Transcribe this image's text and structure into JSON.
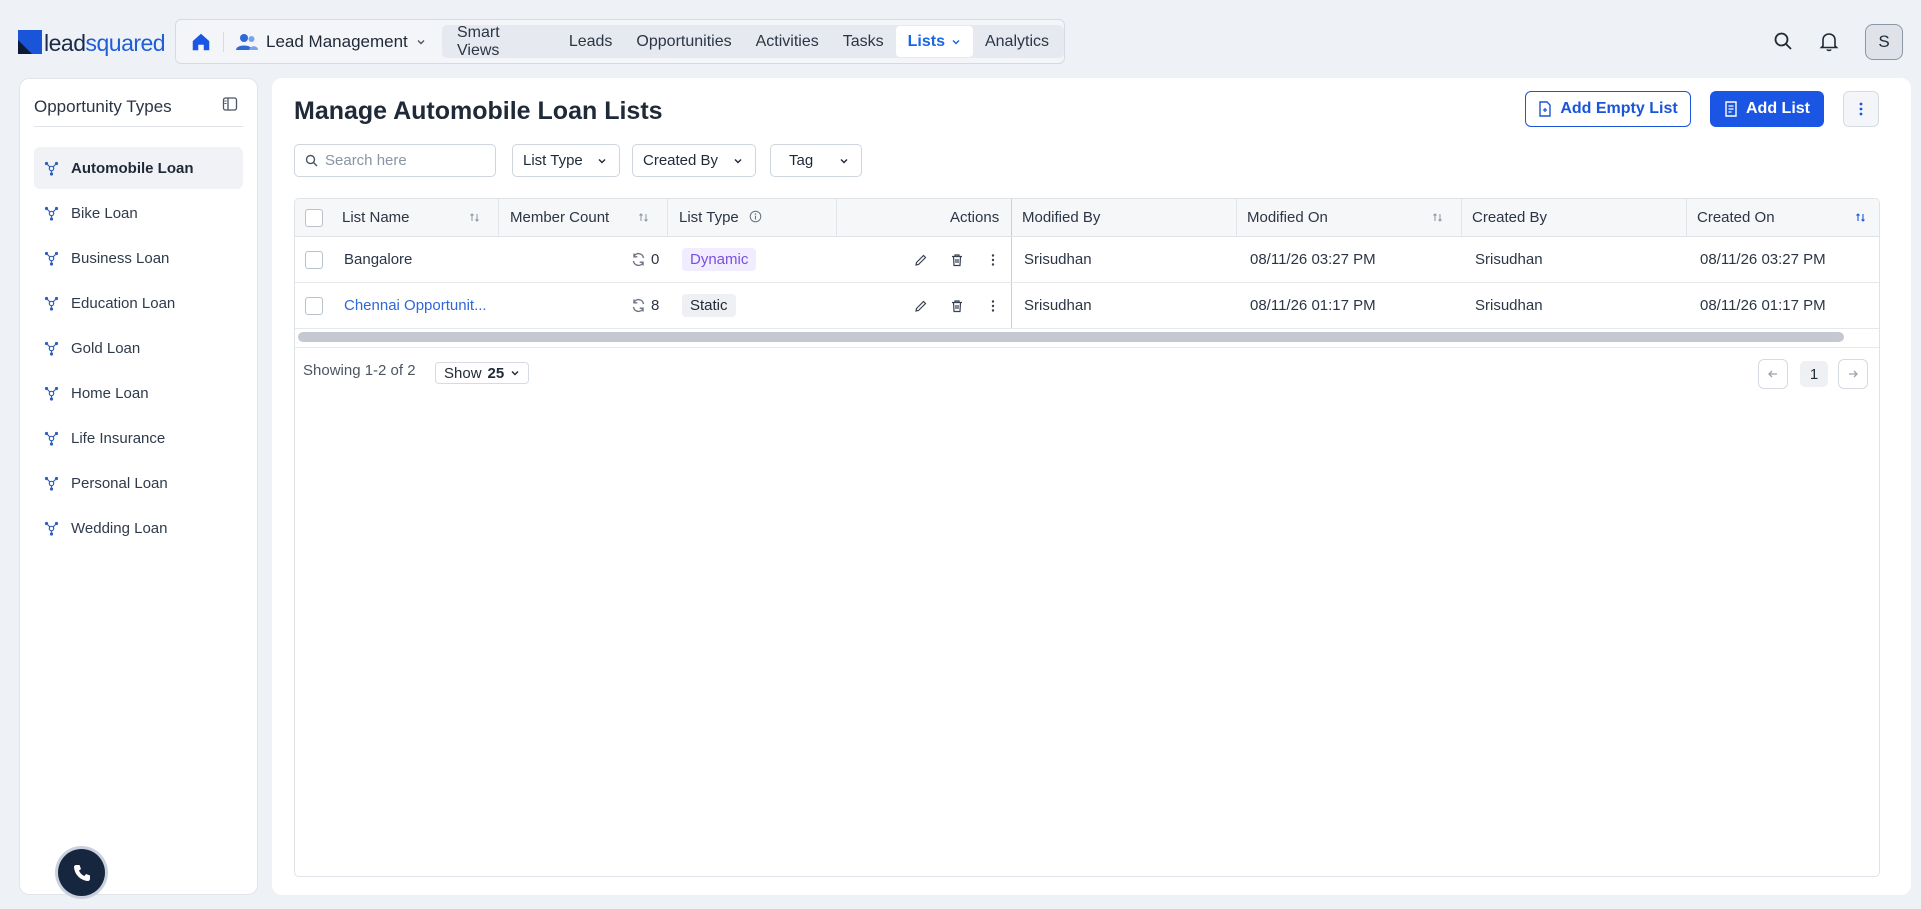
{
  "logo": {
    "part1": "lead",
    "part2": "squared"
  },
  "nav": {
    "app_label": "Lead Management",
    "items": [
      "Smart Views",
      "Leads",
      "Opportunities",
      "Activities",
      "Tasks",
      "Lists",
      "Analytics"
    ],
    "active": "Lists"
  },
  "user": {
    "avatar_initial": "S"
  },
  "sidebar": {
    "title": "Opportunity Types",
    "items": [
      "Automobile Loan",
      "Bike Loan",
      "Business Loan",
      "Education Loan",
      "Gold Loan",
      "Home Loan",
      "Life Insurance",
      "Personal Loan",
      "Wedding Loan"
    ],
    "active": "Automobile Loan"
  },
  "page": {
    "title": "Manage Automobile Loan Lists",
    "add_empty_list": "Add Empty List",
    "add_list": "Add List"
  },
  "filters": {
    "search_placeholder": "Search here",
    "list_type": "List Type",
    "created_by": "Created By",
    "tag": "Tag"
  },
  "table": {
    "headers": {
      "list_name": "List Name",
      "member_count": "Member Count",
      "list_type": "List Type",
      "actions": "Actions",
      "modified_by": "Modified By",
      "modified_on": "Modified On",
      "created_by": "Created By",
      "created_on": "Created On"
    },
    "rows": [
      {
        "list_name": "Bangalore",
        "member_count": "0",
        "list_type": "Dynamic",
        "modified_by": "Srisudhan",
        "modified_on": "08/11/26 03:27 PM",
        "created_by": "Srisudhan",
        "created_on": "08/11/26 03:27 PM"
      },
      {
        "list_name": "Chennai Opportunit...",
        "member_count": "8",
        "list_type": "Static",
        "modified_by": "Srisudhan",
        "modified_on": "08/11/26 01:17 PM",
        "created_by": "Srisudhan",
        "created_on": "08/11/26 01:17 PM"
      }
    ]
  },
  "footer": {
    "showing": "Showing 1-2 of 2",
    "show_label": "Show",
    "show_value": "25",
    "page": "1"
  },
  "colors": {
    "accent": "#1a55e3",
    "link": "#2f68d8",
    "dynamic_badge": "#7a4fe0",
    "fab": "#16263f"
  }
}
